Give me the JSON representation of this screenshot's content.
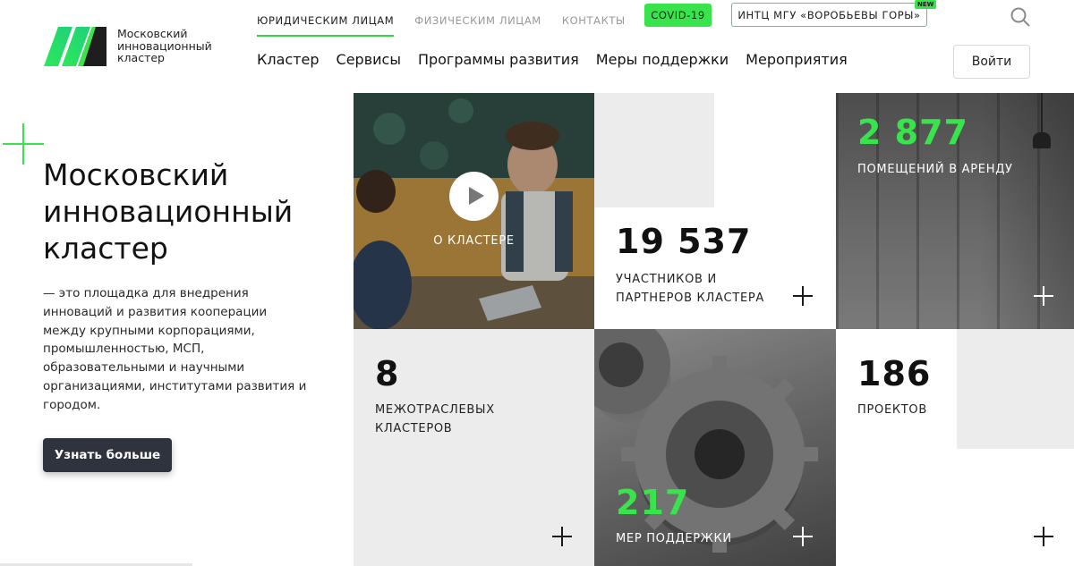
{
  "logo": {
    "lines": [
      "Московский",
      "инновационный",
      "кластер"
    ],
    "colors": {
      "green": "#39e34b",
      "dark": "#1e1e1e"
    }
  },
  "top_nav": {
    "items": [
      {
        "label": "ЮРИДИЧЕСКИМ ЛИЦАМ",
        "active": true
      },
      {
        "label": "ФИЗИЧЕСКИМ ЛИЦАМ",
        "active": false
      },
      {
        "label": "КОНТАКТЫ",
        "active": false
      }
    ],
    "covid": "COVID-19",
    "intc": "ИНТЦ МГУ «ВОРОБЬЕВЫ ГОРЫ»",
    "new_badge": "NEW"
  },
  "main_nav": {
    "items": [
      "Кластер",
      "Сервисы",
      "Программы развития",
      "Меры поддержки",
      "Мероприятия"
    ]
  },
  "login_label": "Войти",
  "hero": {
    "title_lines": [
      "Московский",
      "инновационный",
      "кластер"
    ],
    "description": "— это площадка для внедрения инноваций и развития кооперации между крупными корпорациями, промышленностью, МСП, образовательными и научными организациями, институтами развития и городом.",
    "button": "Узнать больше"
  },
  "tiles": {
    "video": {
      "label": "О КЛАСТЕРЕ"
    },
    "participants": {
      "number": "19 537",
      "label_lines": [
        "УЧАСТНИКОВ И",
        "ПАРТНЕРОВ КЛАСТЕРА"
      ]
    },
    "rooms": {
      "number": "2 877",
      "label": "ПОМЕЩЕНИЙ В АРЕНДУ"
    },
    "clusters": {
      "number": "8",
      "label_lines": [
        "МЕЖОТРАСЛЕВЫХ",
        "КЛАСТЕРОВ"
      ]
    },
    "support": {
      "number": "217",
      "label": "МЕР ПОДДЕРЖКИ"
    },
    "projects": {
      "number": "186",
      "label": "ПРОЕКТОВ"
    }
  },
  "accent_color": "#39e34b"
}
